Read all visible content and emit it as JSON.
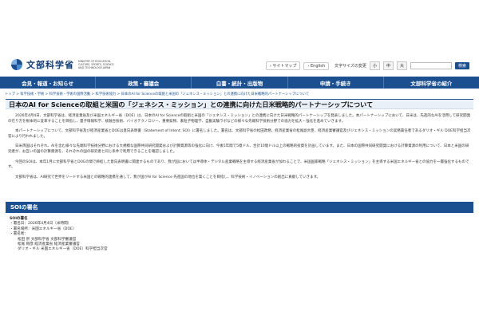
{
  "header": {
    "logo_text": "文部科学省",
    "logo_sub": "MINISTRY OF EDUCATION, CULTURE, SPORTS, SCIENCE AND TECHNOLOGY-JAPAN",
    "sitemap": "サイトマップ",
    "english": "English",
    "font_size_label": "文字サイズの変更",
    "size_small": "小",
    "size_medium": "中",
    "size_large": "大",
    "search_button": "検索"
  },
  "nav": {
    "items": [
      "会見・報道・お知らせ",
      "政策・審議会",
      "白書・統計・出版物",
      "申請・手続き",
      "文部科学省の紹介"
    ]
  },
  "breadcrumb": "トップ > 科学技術・学術 > 科学技術・学術の国際活動 > 科学技術協力 > 日本のAI for Scienceの取組と米国の「ジェネシス・ミッション」との連携に向けた日米戦略的パートナーシップについて",
  "page_title": "日本のAI for Scienceの取組と米国の「ジェネシス・ミッション」との連携に向けた日米戦略的パートナーシップについて",
  "body": {
    "p1": "2026年4月4日、文部科学省は、経済産業省及び米国エネルギー省（DOE）は、日本のAI for Scienceの取組と米国の「ジェネシス・ミッション」との連携に向けた日米戦略的パートナーシップを発表しました。本パートナーシップにおいて、日米は、先進的なAIを活用して研究開発の在り方を根本的に変革することを目指し、量子情報科学、核融合技術、バイオテクノロジー、重要鉱物、素粒子物理学、自動実験ラボなどの様々な先端科学技術分野での協力を拡大・強化を進めていきます。",
    "p2": "本パートナーシップについて、文部科学省及び経済産業省とDOEは意向表明書（Statement of Intent: SOI）に署名しました。署名は、文部科学省の松田政務、経済産業省の松尾副大臣、経済産業審議官及びジェネシス・ミッションの実務責任者であるダリオ・ギル DOE科学担当次官により行われました。",
    "p3": "日米両国はそれぞれ、AIを含む様々な先端科学技術分野における大規模な国際共同研究開発および計算資源等の強化に向け、今後5年間で5億ドル、合計10億ドル以上の戦略的投資を計画しています。また、日本の国際共同研究開発における計算資源の利用について、日本と米国の研究者が、お互いの国の計算資源を、それぞれの国の研究者と同じ条件で利用できることを確認しました。",
    "p4": "今回のSOIは、本年1月に文部科学省とDOEの間で締結した意向表明書に関連するものであり、我が国においては半導体・デジタル産業戦略を主導する経済産業省が加わることで、米国国家戦略「ジェネシス・ミッション」を主導する米国エネルギー省との協力を一層強化するものです。",
    "p5": "文部科学省は、AI研究で世界をリードする米国との戦略的連携を通して、我が国がAI for Science 先進国の地位を築くことを目指し、科学技術・イノベーションの創出に貢献していきます。"
  },
  "section": {
    "title": "SOIの署名",
    "heading": "SOIの署名",
    "date": "・署名日：2026年4月4日（米時間）",
    "place": "・署名場所：米国エネルギー省（DOE）",
    "signers_label": "・署名者：",
    "signer1": "松田 崇 文部科学省 文部科学審議官",
    "signer2": "松尾 剛彦 経済産業省 経済産業審議官",
    "signer3": "ダリオ・ギル 米国エネルギー省（DOE）科学担当次官"
  }
}
